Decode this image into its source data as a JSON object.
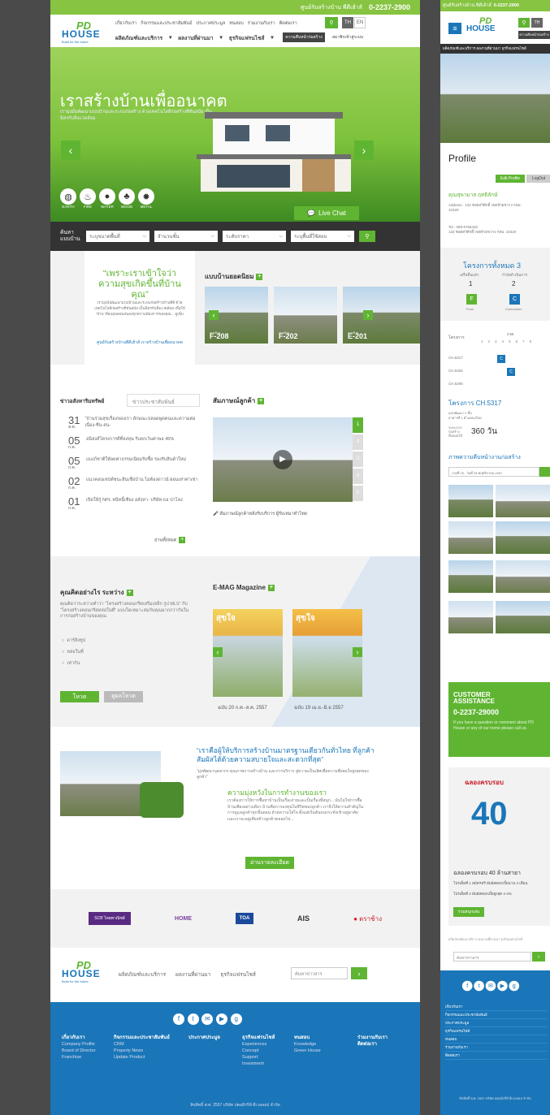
{
  "topbar": {
    "label": "ศูนย์รับสร้างบ้าน พีดีเฮ้าส์",
    "phone": "0-2237-2900"
  },
  "nav": {
    "row1": [
      "เกี่ยวกับเรา",
      "กิจกรรมและประชาสัมพันธ์",
      "ประกาศประมูล",
      "ทนสอบ",
      "ร่วมงานกับเรา",
      "ติดต่อเรา"
    ],
    "lang_th": "TH",
    "lang_en": "EN",
    "row2": [
      "ผลิตภัณฑ์และบริการ",
      "ผลงานที่ผ่านมา",
      "ธุรกิจแฟรนไชส์"
    ],
    "btn_progress": "ความคืบหน้าก่อสร้าง",
    "btn_member": "สมาชิกเข้าสู่ระบบ"
  },
  "logo": {
    "main": "PD",
    "sub": "HOUSE",
    "tag": "Build for the future"
  },
  "hero": {
    "title": "เราสร้างบ้านเพื่ออนาคต",
    "subtitle": "เรามุ่งมั่นพัฒนาแบบบ้านและระบบก่อสร้าง ด้วยเทคโนโลยีก่อสร้างที่ทันสมัย เป็นมิตรกับสิ่งแวดล้อม",
    "icons": [
      "EARTH",
      "FIRE",
      "WATER",
      "WOOD",
      "METAL"
    ],
    "live_chat": "Live Chat"
  },
  "search": {
    "label": "ค้นหาแบบบ้าน",
    "fields": [
      "ระบุขนาดพื้นที่",
      "จำนวนชั้น",
      "ระดับราคา",
      "ระบุพื้นที่ใช้สอย"
    ]
  },
  "quote": {
    "text": "“เพราะเราเข้าใจว่าความสุขเกิดขึ้นที่บ้านคุณ”",
    "body": "เรามุ่งมั่นพัฒนาแบบบ้านและระบบก่อสร้างบ้านที่ดี ด้วยเทคโนโลยีก่อสร้างที่ทันสมัย เป็นมิตรกับสิ่งแวดล้อม เพื่อให้ ‘บ้าน’ ที่อบอุ่นตอบสนองทุกความต้องการของคุณ... ดูเพิ่ม",
    "link": "ศูนย์รับสร้างบ้านพีดีเฮ้าส์ เราสร้างบ้านเพื่ออนาคต"
  },
  "popular": {
    "title": "แบบบ้านยอดนิยม",
    "items": [
      {
        "prefix": "แบบบ้าน",
        "code": "F-208"
      },
      {
        "prefix": "แบบบ้าน",
        "code": "F-202"
      },
      {
        "prefix": "แบบบ้าน",
        "code": "E-201"
      }
    ]
  },
  "news": {
    "tab_active": "ข่าวอสังหาริมทรัพย์",
    "tab_other": "ข่าวประชาสัมพันธ์",
    "items": [
      {
        "day": "31",
        "mon": "ส.ค.",
        "text": "“บ้านร่วมสุขเรื่องของเรา ลักษณะปลอดพูดคนและความต่อเนื่อง-ชีน-สน-"
      },
      {
        "day": "05",
        "mon": "ก.ค.",
        "text": "อนิสงส์โครงการดีที่ลงทุน รับยกเว้นค่าพอ 45%"
      },
      {
        "day": "05",
        "mon": "ก.ค.",
        "text": "แบงก์ชาติให้ลดค่าธรรมเนียมรับซื้อ รองรับสินค้าใหม่"
      },
      {
        "day": "02",
        "mon": "ก.ค.",
        "text": "แนวคอนเซปต์ชนะสินเชื่อบ้าน ไม่ต้องดาวน์ ผ่อนเท่าค่าเช่า"
      },
      {
        "day": "01",
        "mon": "ก.ค.",
        "text": "เปิดให้กู้ NPL หนีหนี้เชียง อสังหา- บริษัท-ธอ ปาโลง"
      }
    ],
    "more": "อ่านทั้งหมด"
  },
  "customer": {
    "title": "สัมภาษณ์ลูกค้า",
    "caption": "สัมภาษณ์ลูกค้าหลังรับบริการ ผู้รับเหมาทำไทย",
    "pages": [
      "1",
      "2",
      "3",
      "4",
      "5"
    ]
  },
  "poll": {
    "title": "คุณคิดอย่างไร ระหว่าง",
    "question": "คุณคิดว่าระหว่างคำว่า “โครงสร้างคอนกรีตเสริมเหล็ก รูป MLS” กับ “โครงสร้างคอนกรีตหล่อในที่” แบบใดเหมาะสมกับคุณมากกว่ากันในการก่อสร้างบ้านของคุณ",
    "options": [
      "ดาร์ลิงซูป",
      "หล่อในที่",
      "เท่ากัน"
    ],
    "vote": "โหวต",
    "result": "ดูผลโหวต"
  },
  "emag": {
    "title": "E-MAG Magazine",
    "items": [
      {
        "cover": "สุขใจ",
        "caption": "ฉบับ 20 ก.ค.-ส.ค. 2557"
      },
      {
        "cover": "สุขใจ",
        "caption": "ฉบับ 19 เม.ย.-มิ.ย 2557"
      }
    ]
  },
  "about": {
    "headline": "“เราคือผู้ให้บริการสร้างบ้านมาตรฐานเดียวกันทั่วไทย ที่ลูกค้าสัมผัสได้ด้วยความสบายใจและสะดวกที่สุด”",
    "sub": "“มุ่งพัฒนาบุคลากร คุณภาพการสร้างบ้าน และการบริการ สู่ความเป็นเลิศเพื่อความพึงพอใจสูงสุดของลูกค้า”",
    "mission_title": "ความมุ่งหวังในการทำงานของเรา",
    "mission_body": "เราต้องการให้การซื้อหาบ้านเป็นเรื่องง่ายและเป็นเรื่องที่สนุก... มันไม่ใช่การซื้อบ้านเพียงอย่างเดียว บ้านคือการลงทุนในชีวิตของลูกค้า เราจึงให้ความสำคัญในการดูแลลูกค้าทุกขั้นตอน ด้วยความใส่ใจ ตั้งแต่เริ่มต้นจนกระทั่งเข้าอยู่อาศัย และเราจะอยู่เคียงข้างลูกค้าตลอดไป...",
    "btn": "อ่านรายละเอียด"
  },
  "partners": {
    "scb": "SCB ไทยพาณิชย์",
    "home": "HOME",
    "toa": "TOA",
    "ais": "AIS",
    "chang": "ตราช้าง"
  },
  "footer_nav": {
    "links": [
      "ผลิตภัณฑ์และบริการ",
      "ผลงานที่ผ่านมา",
      "ธุรกิจแฟรนไชส์"
    ],
    "search_placeholder": "ค้นหาข่าวสาร"
  },
  "footer": {
    "cols": [
      {
        "h": "เกี่ยวกับเรา",
        "items": [
          "Company Profile",
          "Board of Director",
          "Franchise"
        ]
      },
      {
        "h": "กิจกรรมและประชาสัมพันธ์",
        "items": [
          "CRM",
          "Property News",
          "Update Product"
        ]
      },
      {
        "h": "ประกาศประมูล",
        "items": []
      },
      {
        "h": "ธุรกิจแฟรนไชส์",
        "items": [
          "Experiences",
          "Concept",
          "Support",
          "Investment"
        ]
      },
      {
        "h": "ทนสอบ",
        "items": [
          "Knowledge",
          "Green House"
        ]
      },
      {
        "h": "ร่วมงานกับเรา",
        "items": [
          "ติดต่อเรา"
        ]
      }
    ],
    "copy": "ลิขสิทธิ์ พ.ศ. 2557 บริษัท ปตอมิรรีท์ ดีเวลลอป จำกัด",
    "social": [
      "f",
      "t",
      "✉",
      "▶",
      "g"
    ]
  },
  "mobile": {
    "topbar": "ศูนย์รับสร้างบ้าน พีดีเฮ้าส์",
    "phone": "0-2237-2900",
    "btn1": "ความคืบหน้าก่อสร้าง",
    "subnav": "ผลิตภัณฑ์และบริการ ผลงานที่ผ่านมา ธุรกิจแฟรนไชส์",
    "profile": "Profile",
    "edit": "Edit Profile",
    "logout": "LogOut",
    "name": "คุณสุพามาส ฤทธิลักษ์",
    "address": "Address : 132 ซอยทวีศักดิ์ เขตห้วยขวาง กทม. 10320",
    "tel": "Tel : 089-6765432",
    "address2": "132 ซอยทวีศักดิ์ เขตห้วยขวาง กทม. 10320",
    "project_title": "โครงการทั้งหมด 3",
    "proj_labels": [
      "เสร็จสิ้นแล้ว",
      "กำลังดำเนินการ"
    ],
    "proj_counts": [
      "1",
      "2"
    ],
    "proj_badges": [
      "F",
      "C"
    ],
    "proj_sub": [
      "Final",
      "Contruction"
    ],
    "table_head": "โครงการ",
    "table_mid": "งวด",
    "table_nums": [
      "1",
      "2",
      "3",
      "4",
      "5",
      "6",
      "7",
      "8"
    ],
    "rows": [
      "CH.5317",
      "CH.5326",
      "CH.5290"
    ],
    "row_badges": [
      "C",
      "C"
    ],
    "ch_title": "โครงการ CH.5317",
    "ch_info1": "แบบพัฒนา 2 ชั้น",
    "ch_info2": "อาคารที่ 1 ตำแหน่งใหม่",
    "duration_label": "ระยะเวลาก่อสร้าง ทั้งหมดใช้",
    "duration": "360 วัน",
    "progress_title": "ภาพความคืบหน้างานก่อสร้าง",
    "progress_date": "งวดที่ 25 : วันที่ 28 พฤศจิกายน 2557",
    "assist_title": "CUSTOMER ASSISTANCE",
    "assist_phone": "0-2237-29000",
    "assist_text": "If you have a question or comment about PD House or any of our home please call us.",
    "promo_title": "ฉลองครบรอบ",
    "promo_big": "40",
    "promo_line": "ฉลองครบรอบ 40 ล้านสายา",
    "promo_l1": "โปรเด็ดที่ 1 สมัครฟรี สัมผัสดอกเบี้ยนาน 4 เดือน",
    "promo_l2": "โปรเด็ดที่ 2 สัมผัสดอกเบี้ยสูงสุด 4-4%",
    "promo_btn": "ร่วมสนุกเล่น",
    "search_ph": "ค้นหาข่าวสาร",
    "menu": [
      "เกี่ยวกับเรา",
      "กิจกรรมและประชาสัมพันธ์",
      "ประกาศประมูล",
      "ธุรกิจแฟรนไชส์",
      "ทนสอบ",
      "ร่วมงานกับเรา",
      "ติดต่อเรา"
    ],
    "copy": "ลิขสิทธิ์ พ.ศ. 2557 บริษัท ปตอมิรรีท์ ดีเวลลอป จำกัด"
  },
  "colors": {
    "green": "#5fb532",
    "light_green": "#86c441",
    "blue": "#1a76b8"
  }
}
